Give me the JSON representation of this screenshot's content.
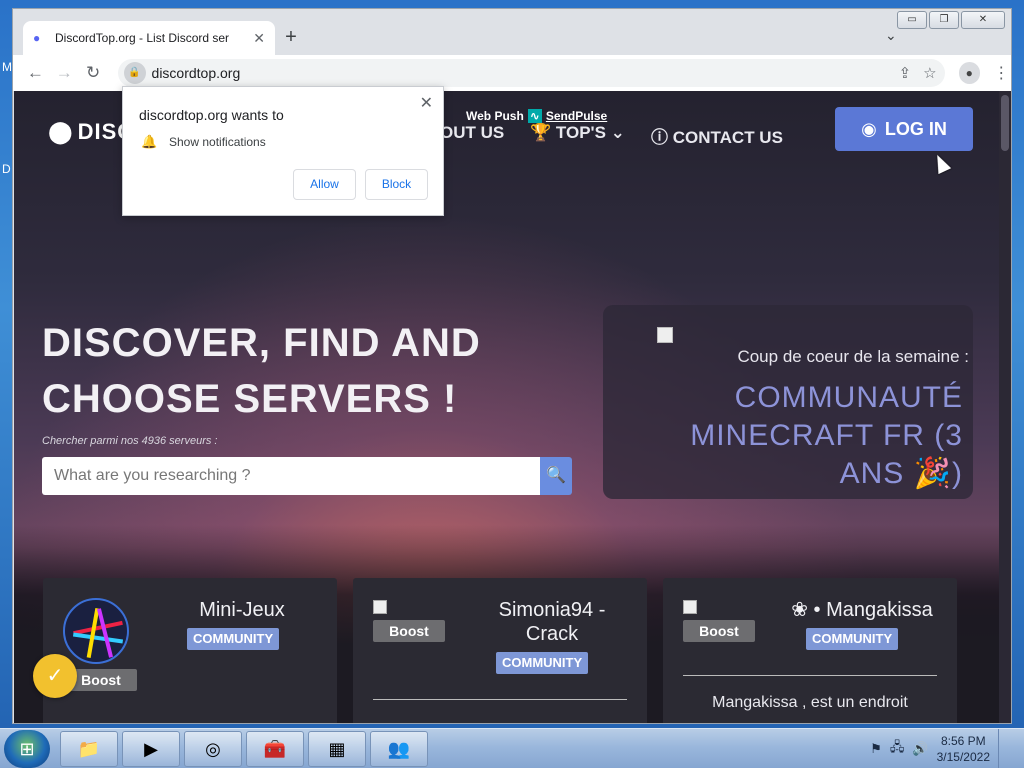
{
  "desktop": {
    "label_top": "M",
    "label_mid": "D"
  },
  "browser": {
    "tab": {
      "title": "DiscordTop.org - List Discord ser",
      "close": "✕"
    },
    "new_tab": "+",
    "tab_search": "⌄",
    "window_controls": {
      "minimize": "▭",
      "restore": "❐",
      "close": "✕"
    },
    "nav": {
      "back": "←",
      "forward": "→",
      "reload": "↻"
    },
    "url": "discordtop.org",
    "toolbar_icons": {
      "share": "⇪",
      "star": "☆",
      "profile": "●",
      "menu": "⋮"
    }
  },
  "site": {
    "logo_text": "DISC",
    "nav": {
      "about": "OUT US",
      "tops": "TOP'S",
      "contact": "CONTACT US"
    },
    "webpush": {
      "label": "Web Push",
      "brand": "SendPulse"
    },
    "login": "LOG IN",
    "hero": {
      "title_line1": "DISCOVER, FIND AND",
      "title_line2": "CHOOSE SERVERS !",
      "sub": "Chercher parmi nos 4936 serveurs :",
      "search_placeholder": "What are you researching ?"
    },
    "featured": {
      "caption": "Coup de coeur de la semaine :",
      "name_line1": "COMMUNAUTÉ",
      "name_line2": "MINECRAFT FR (3",
      "name_line3": "ANS 🎉)"
    },
    "cards": [
      {
        "title": "Mini-Jeux",
        "tag": "COMMUNITY",
        "boost": "Boost"
      },
      {
        "title_line1": "Simonia94 -",
        "title_line2": "Crack",
        "tag": "COMMUNITY",
        "boost": "Boost"
      },
      {
        "title": "❀ • Mangakissa",
        "tag": "COMMUNITY",
        "boost": "Boost",
        "desc": "Mangakissa , est un endroit"
      }
    ]
  },
  "popup": {
    "title": "discordtop.org wants to",
    "permission": "Show notifications",
    "allow": "Allow",
    "block": "Block",
    "close": "✕"
  },
  "taskbar": {
    "clock_time": "8:56 PM",
    "clock_date": "3/15/2022"
  }
}
